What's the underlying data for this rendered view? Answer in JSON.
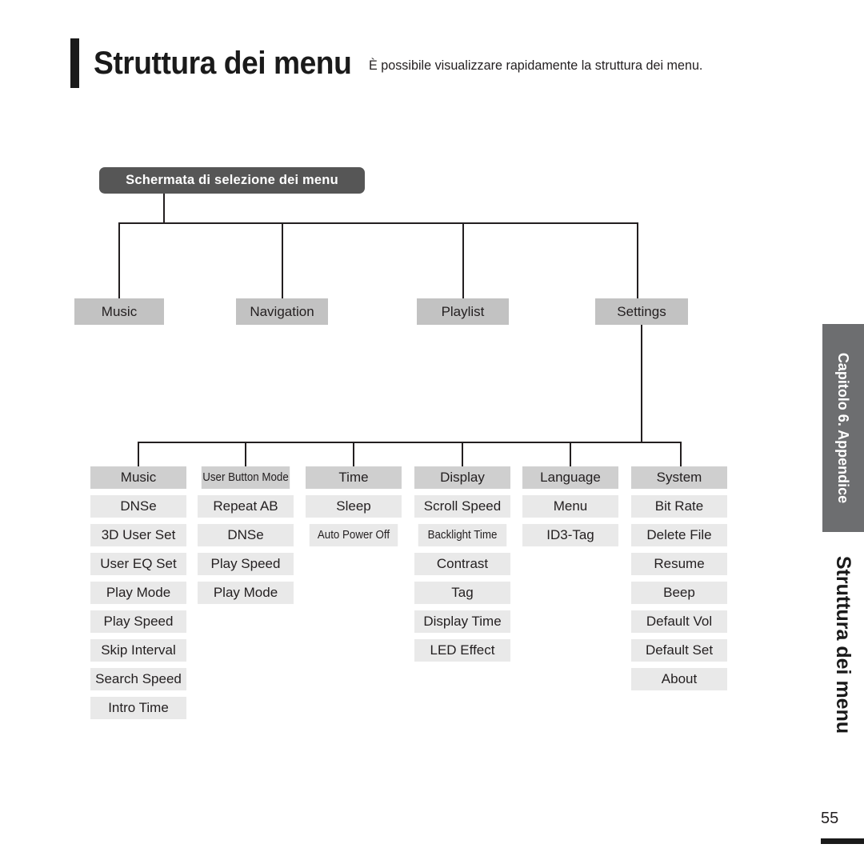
{
  "header": {
    "title": "Struttura dei menu",
    "subtitle": "È possibile visualizzare rapidamente la struttura dei menu."
  },
  "diagram": {
    "root_label": "Schermata di selezione dei menu",
    "level1": [
      {
        "label": "Music"
      },
      {
        "label": "Navigation"
      },
      {
        "label": "Playlist"
      },
      {
        "label": "Settings"
      }
    ],
    "level2": [
      {
        "header": "Music",
        "items": [
          "DNSe",
          "3D User Set",
          "User EQ Set",
          "Play Mode",
          "Play Speed",
          "Skip Interval",
          "Search Speed",
          "Intro Time"
        ]
      },
      {
        "header": "User Button Mode",
        "items": [
          "Repeat AB",
          "DNSe",
          "Play Speed",
          "Play Mode"
        ]
      },
      {
        "header": "Time",
        "items": [
          "Sleep",
          "Auto Power Off"
        ]
      },
      {
        "header": "Display",
        "items": [
          "Scroll Speed",
          "Backlight Time",
          "Contrast",
          "Tag",
          "Display Time",
          "LED Effect"
        ]
      },
      {
        "header": "Language",
        "items": [
          "Menu",
          "ID3-Tag"
        ]
      },
      {
        "header": "System",
        "items": [
          "Bit Rate",
          "Delete File",
          "Resume",
          "Beep",
          "Default Vol",
          "Default Set",
          "About"
        ]
      }
    ]
  },
  "sidebar": {
    "chapter_label": "Capitolo 6. Appendice",
    "section_label": "Struttura dei menu",
    "page_number": "55"
  },
  "colors": {
    "root_node_bg": "#565656",
    "level1_bg": "#c2c2c2",
    "level2_header_bg": "#cfcfcf",
    "level2_item_bg": "#e9e9e9",
    "chapter_tab_bg": "#6d6e70",
    "line": "#231f20",
    "text": "#231f20"
  }
}
